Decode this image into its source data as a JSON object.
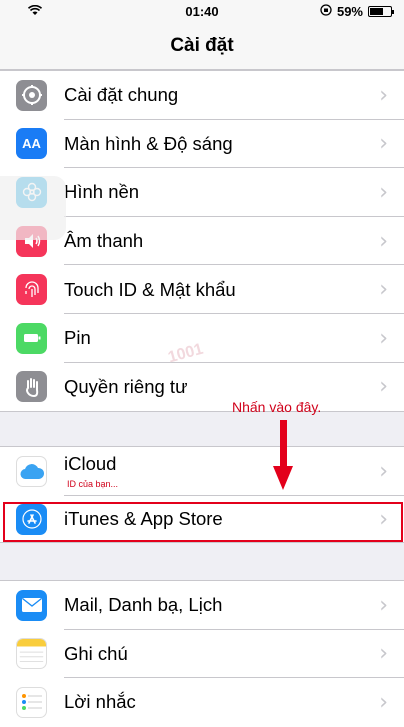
{
  "status_bar": {
    "time": "01:40",
    "battery": "59%",
    "battery_level": 0.59
  },
  "nav": {
    "title": "Cài đặt"
  },
  "group1": [
    {
      "label": "Cài đặt chung",
      "icon": "gear-icon",
      "color": "#8e8e93"
    },
    {
      "label": "Màn hình & Độ sáng",
      "icon": "display-icon",
      "color": "#1a7cf5"
    },
    {
      "label": "Hình nền",
      "icon": "wallpaper-icon",
      "color": "#2fb2e8"
    },
    {
      "label": "Âm thanh",
      "icon": "sound-icon",
      "color": "#f5355a"
    },
    {
      "label": "Touch ID & Mật khẩu",
      "icon": "fingerprint-icon",
      "color": "#f5355a"
    },
    {
      "label": "Pin",
      "icon": "battery-icon",
      "color": "#4cd964"
    },
    {
      "label": "Quyền riêng tư",
      "icon": "hand-icon",
      "color": "#8e8e93"
    }
  ],
  "group2": [
    {
      "label": "iCloud",
      "sub": "ID của bạn...",
      "icon": "icloud-icon",
      "color": "#ffffff"
    },
    {
      "label": "iTunes & App Store",
      "icon": "app-store-icon",
      "color": "#1a8cf5"
    }
  ],
  "group3": [
    {
      "label": "Mail, Danh bạ, Lịch",
      "icon": "mail-icon",
      "color": "#1a8cf5"
    },
    {
      "label": "Ghi chú",
      "icon": "notes-icon",
      "color": "#ffffff"
    },
    {
      "label": "Lời nhắc",
      "icon": "reminders-icon",
      "color": "#ffffff"
    }
  ],
  "annotation": {
    "text": "Nhấn vào đây."
  },
  "watermark": {
    "text": "1001"
  }
}
